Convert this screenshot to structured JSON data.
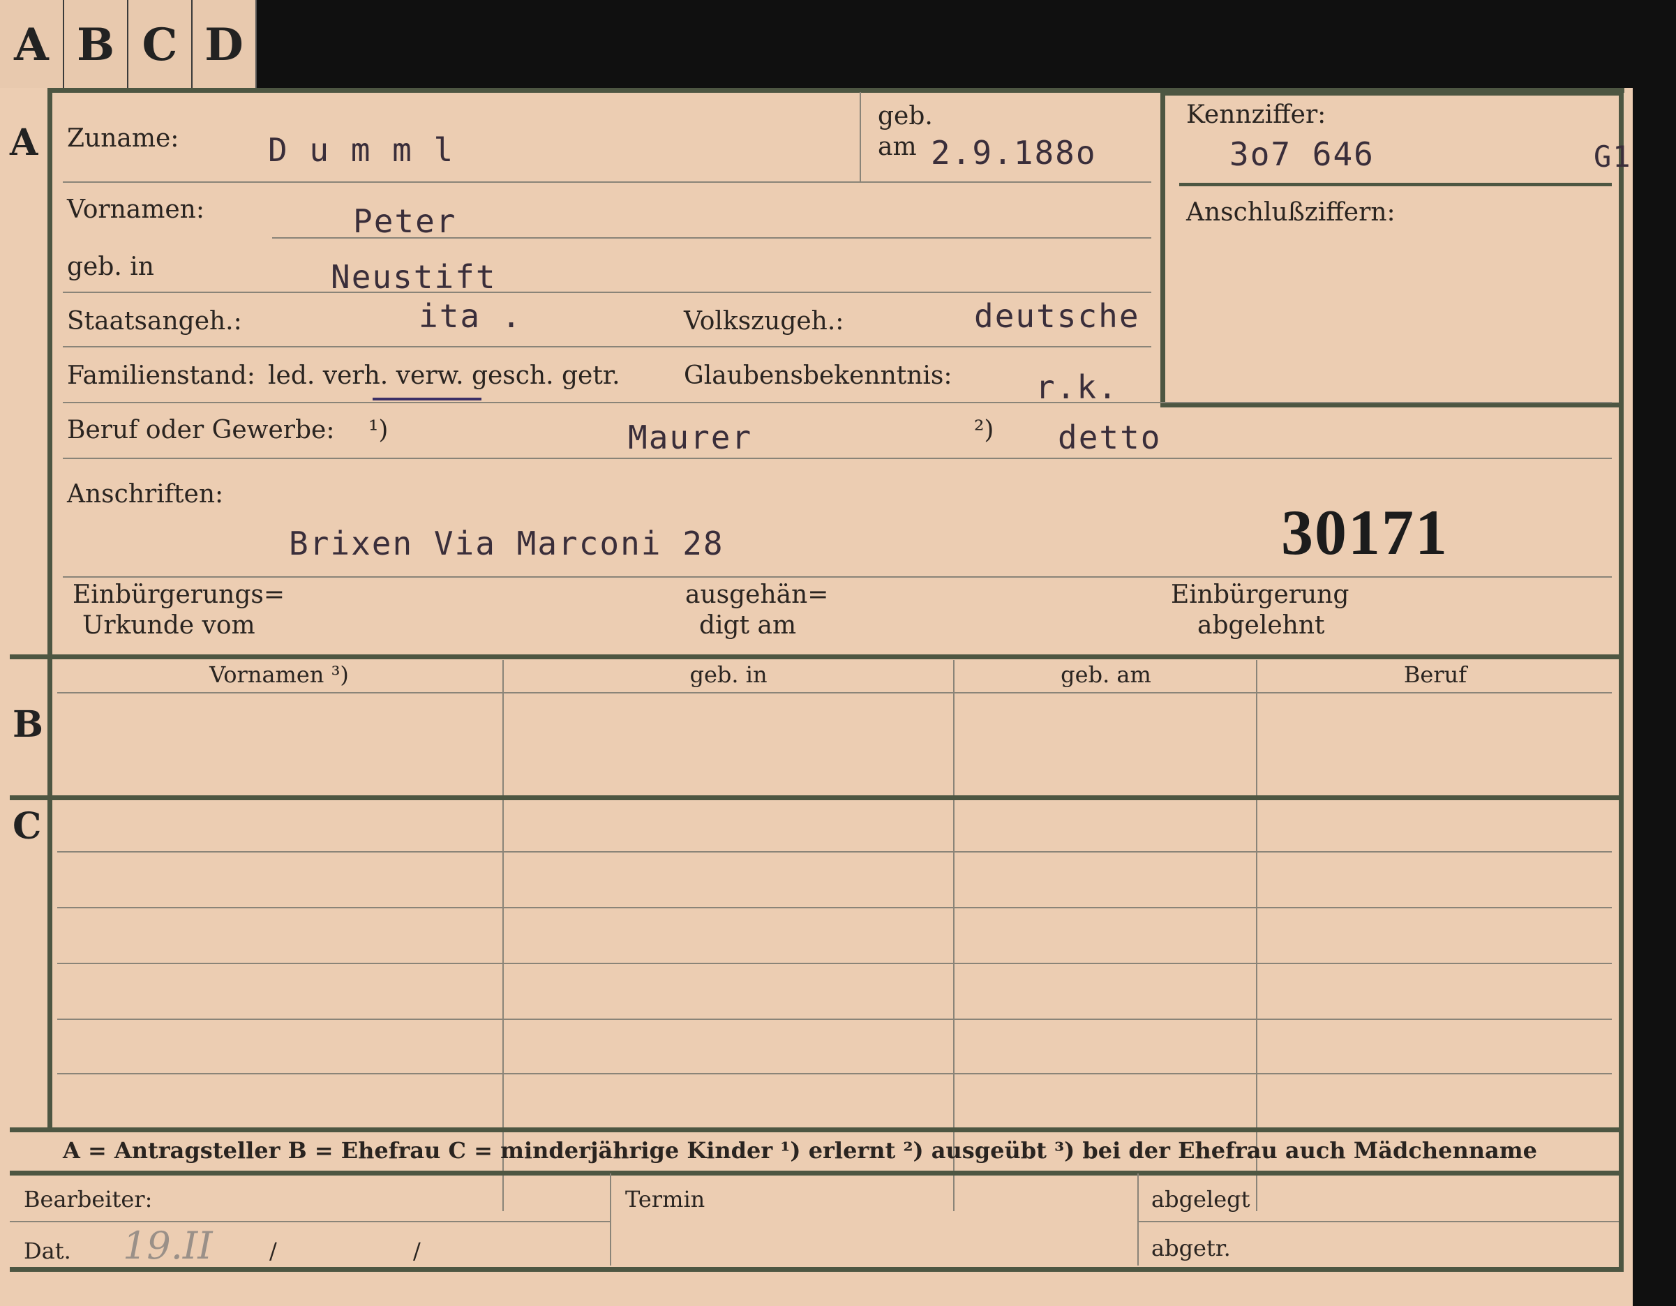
{
  "tabs": [
    "A",
    "B",
    "C",
    "D"
  ],
  "sections": {
    "a": "A",
    "b": "B",
    "c": "C"
  },
  "person": {
    "surname_label": "Zuname:",
    "surname": "D u m m l",
    "born_label_1": "geb.",
    "born_label_2": "am",
    "born_date": "2.9.188o",
    "id_label": "Kennziffer:",
    "id_value": "3o7 646",
    "id_suffix": "G1",
    "link_label": "Anschlußziffern:",
    "firstnames_label": "Vornamen:",
    "firstnames": "Peter",
    "birthplace_label": "geb. in",
    "birthplace": "Neustift",
    "citizenship_label": "Staatsangeh.:",
    "citizenship": "ita .",
    "ethnicity_label": "Volkszugeh.:",
    "ethnicity": "deutsche",
    "marital_label": "Familienstand:",
    "marital_options": "led. verh. verw. gesch. getr.",
    "religion_label": "Glaubensbekenntnis:",
    "religion": "r.k.",
    "occupation_label": "Beruf oder Gewerbe:",
    "occupation_note1": "¹)",
    "occupation_learned": "Maurer",
    "occupation_note2": "²)",
    "occupation_practiced": "detto",
    "address_label": "Anschriften:",
    "address": "Brixen  Via Marconi 28",
    "stamp_number": "30171",
    "naturalization_label_1": "Einbürgerungs=",
    "naturalization_label_2": "Urkunde vom",
    "handed_label_1": "ausgehän=",
    "handed_label_2": "digt am",
    "rejected_label_1": "Einbürgerung",
    "rejected_label_2": "abgelehnt"
  },
  "table": {
    "headers": [
      "Vornamen ³)",
      "geb. in",
      "geb. am",
      "Beruf"
    ]
  },
  "legend": "A = Antragsteller   B = Ehefrau   C = minderjährige Kinder   ¹) erlernt   ²) ausgeübt   ³) bei der Ehefrau auch Mädchenname",
  "footer": {
    "processor_label": "Bearbeiter:",
    "date_label": "Dat.",
    "date_value": "19.II",
    "slash1": "/",
    "slash2": "/",
    "deadline_label": "Termin",
    "filed_label": "abgelegt",
    "removed_label": "abgetr."
  }
}
